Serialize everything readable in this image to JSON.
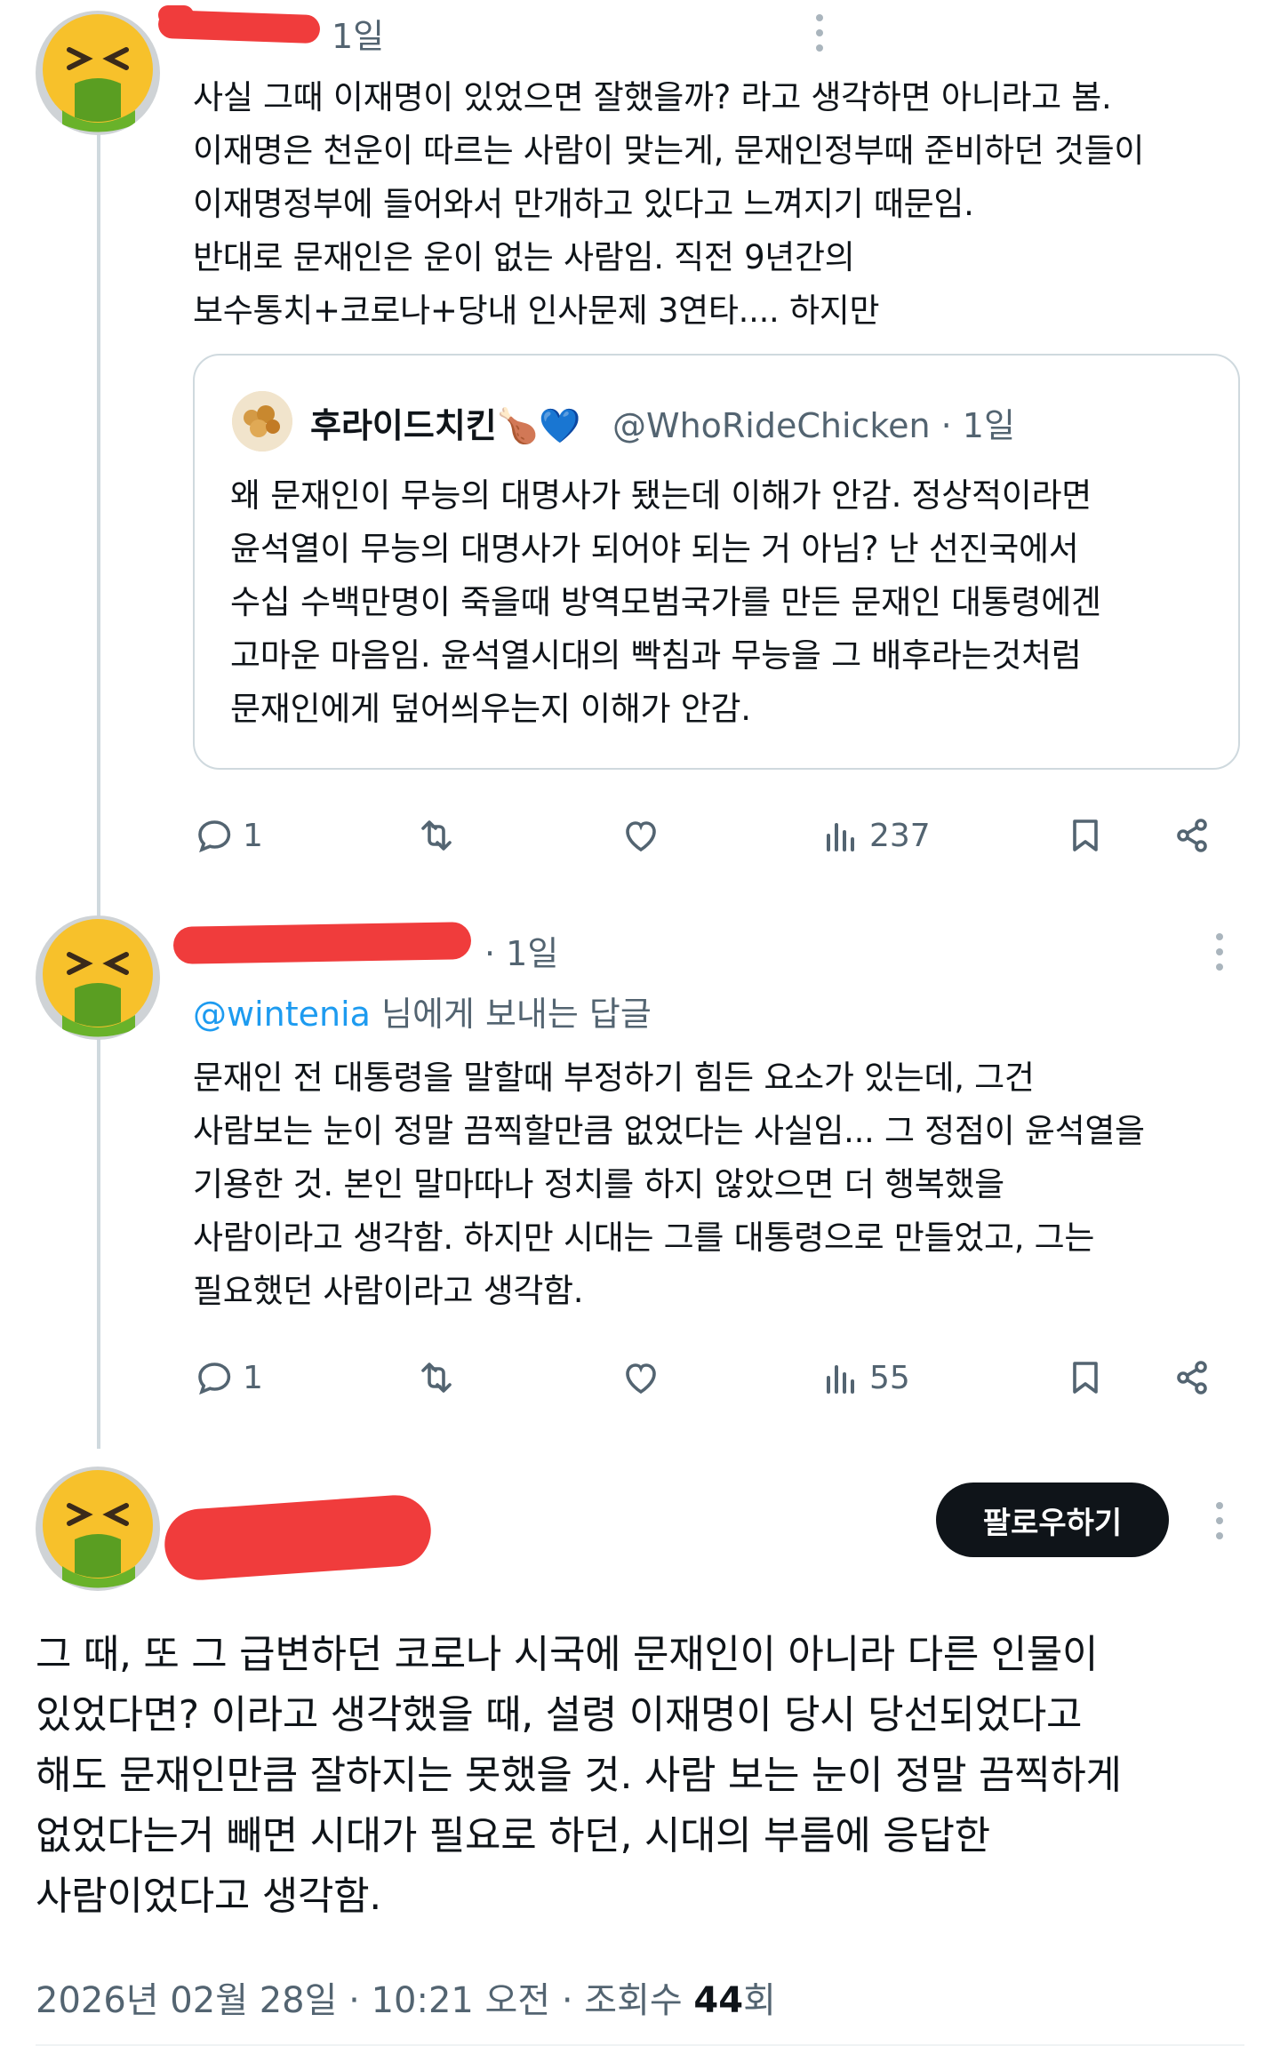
{
  "posts": [
    {
      "time": "1일",
      "text": "사실 그때 이재명이 있었으면 잘했을까? 라고 생각하면 아니라고 봄.\n이재명은 천운이 따르는 사람이 맞는게, 문재인정부때 준비하던 것들이\n이재명정부에 들어와서 만개하고 있다고 느껴지기 때문임.\n반대로 문재인은 운이 없는 사람임. 직전 9년간의\n보수통치+코로나+당내 인사문제 3연타.... 하지만",
      "quote": {
        "name": "후라이드치킨🍗💙",
        "handle": "@WhoRideChicken · 1일",
        "text": "왜 문재인이 무능의 대명사가 됐는데 이해가 안감. 정상적이라면\n윤석열이 무능의 대명사가 되어야 되는 거 아님? 난 선진국에서\n수십 수백만명이 죽을때 방역모범국가를 만든 문재인 대통령에겐\n고마운 마음임. 윤석열시대의 빡침과 무능을 그 배후라는것처럼\n문재인에게 덮어씌우는지 이해가 안감."
      },
      "replies": "1",
      "views": "237"
    },
    {
      "time": "· 1일",
      "reply_mention": "@wintenia",
      "reply_suffix": " 님에게 보내는 답글",
      "text": "문재인 전 대통령을 말할때 부정하기 힘든 요소가 있는데, 그건\n사람보는 눈이 정말 끔찍할만큼 없었다는 사실임... 그 정점이 윤석열을\n기용한 것. 본인 말마따나 정치를 하지 않았으면 더 행복했을\n사람이라고 생각함. 하지만 시대는 그를 대통령으로 만들었고, 그는\n필요했던 사람이라고 생각함.",
      "replies": "1",
      "views": "55"
    }
  ],
  "main_post": {
    "follow_label": "팔로우하기",
    "text": "그 때, 또 그 급변하던 코로나 시국에 문재인이 아니라 다른 인물이\n있었다면? 이라고 생각했을 때, 설령 이재명이 당시 당선되었다고\n해도 문재인만큼 잘하지는 못했을 것. 사람 보는 눈이 정말 끔찍하게\n없었다는거 빼면 시대가 필요로 하던, 시대의 부름에 응답한\n사람이었다고 생각함.",
    "meta_prefix": "2026년 02월 28일 · 10:21 오전 · 조회수 ",
    "meta_views": "44",
    "meta_suffix": "회"
  },
  "colors": {
    "text": "#0f1419",
    "secondary": "#536471",
    "link": "#1d9bf0",
    "redaction": "#f03c3c",
    "thread_line": "#cfd9de"
  },
  "icons": [
    "nauseated-face-emoji",
    "reply-icon",
    "retweet-icon",
    "like-icon",
    "views-icon",
    "bookmark-icon",
    "share-icon",
    "more-icon"
  ]
}
